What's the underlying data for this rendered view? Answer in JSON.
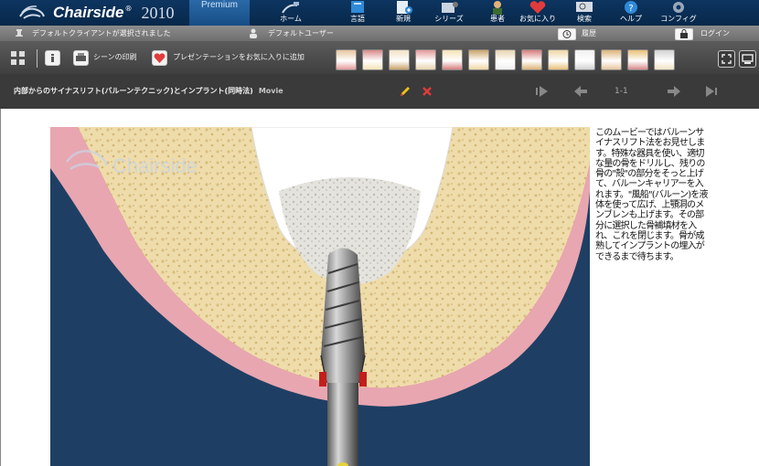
{
  "app": {
    "name": "Chairside",
    "trademark": "®",
    "year": "2010",
    "edition": "Premium"
  },
  "nav": [
    {
      "id": "home",
      "label": "ホーム",
      "icon": "chair-icon"
    },
    {
      "id": "glossary",
      "label": "言語",
      "icon": "book-icon"
    },
    {
      "id": "new",
      "label": "新規",
      "icon": "new-doc-icon"
    },
    {
      "id": "series",
      "label": "シリーズ",
      "icon": "film-icon"
    },
    {
      "id": "patient",
      "label": "患者",
      "icon": "patient-icon"
    },
    {
      "id": "favorites",
      "label": "お気に入り",
      "icon": "heart-icon"
    },
    {
      "id": "search",
      "label": "検索",
      "icon": "search-icon"
    },
    {
      "id": "help",
      "label": "ヘルプ",
      "icon": "help-icon"
    },
    {
      "id": "config",
      "label": "コンフィグ",
      "icon": "gear-icon"
    }
  ],
  "status": {
    "client": "デフォルトクライアントが選択されました",
    "user": "デフォルトユーザー",
    "history": "履歴",
    "login": "ログイン"
  },
  "toolbar": {
    "print_scene": "シーンの印刷",
    "add_favorite": "プレゼンテーションをお気に入りに追加"
  },
  "title": {
    "text": "内部からのサイナスリフト(バルーンテクニック)とインプラント(同時法)",
    "type": "Movie",
    "pages": "1-1"
  },
  "description": "このムービーではバルーンサイナスリフト法をお見せします。特殊な器具を使い、適切な量の骨をドリルし、残りの骨の\"殻\"の部分をそっと上げて、バルーンキャリアーを入れます。\"風船\"(バルーン)を液体を使って広げ、上顎洞のメンブレンも上げます。その部分に選択した骨補填材を入れ、これを閉じます。骨が成熟してインプラントの埋入ができるまで待ちます。",
  "watermark": "Chairside",
  "colors": {
    "topbar": "#0d3560",
    "toolbar": "#4a4a4a",
    "titlebar": "#3a3a3a",
    "accent_red": "#e23b3b",
    "edit_yellow": "#f0c419"
  }
}
